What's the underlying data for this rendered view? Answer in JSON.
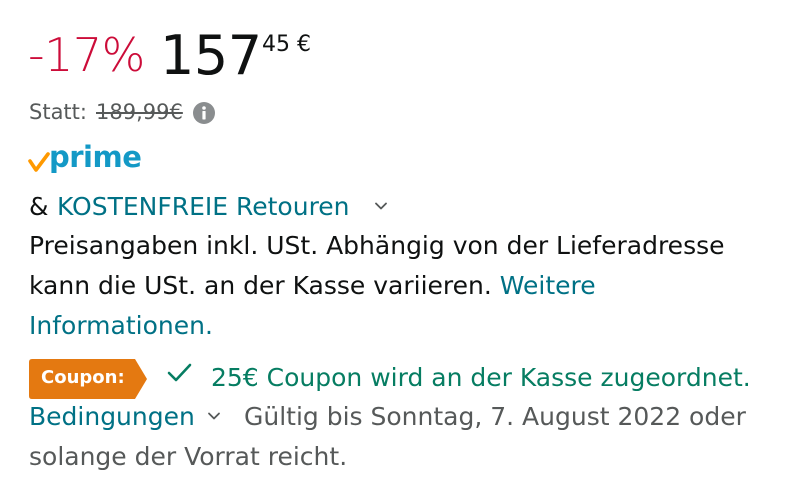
{
  "price": {
    "discount": "-17%",
    "whole": "157",
    "fraction_currency": "45 €"
  },
  "list_price": {
    "label": "Statt:",
    "value": "189,99€",
    "info_icon": "info-icon"
  },
  "prime": {
    "word": "prime",
    "check_icon": "prime-check-icon",
    "brand_color": "#1399c6",
    "check_color": "#f90"
  },
  "returns": {
    "ampersand": "&",
    "link": "KOSTENFREIE Retouren",
    "chevron_icon": "chevron-down-icon"
  },
  "tax_note": {
    "line1": "Preisangaben inkl. USt. Abhängig von der Lieferadresse",
    "line2_text": "kann die USt. an der Kasse variieren.",
    "line2_link": "Weitere",
    "line3_link": "Informationen."
  },
  "coupon": {
    "badge": "Coupon:",
    "badge_color": "#e47911",
    "check_icon": "check-icon",
    "text": "25€ Coupon wird an der Kasse zugeordnet.",
    "text_color": "#067d62",
    "terms_link": "Bedingungen",
    "validity_line1": "Gültig bis Sonntag, 7. August 2022 oder",
    "validity_line2": "solange der Vorrat reicht."
  },
  "colors": {
    "discount": "#cc0c39",
    "link": "#007185",
    "secondary_text": "#565959",
    "text": "#0f1111"
  }
}
